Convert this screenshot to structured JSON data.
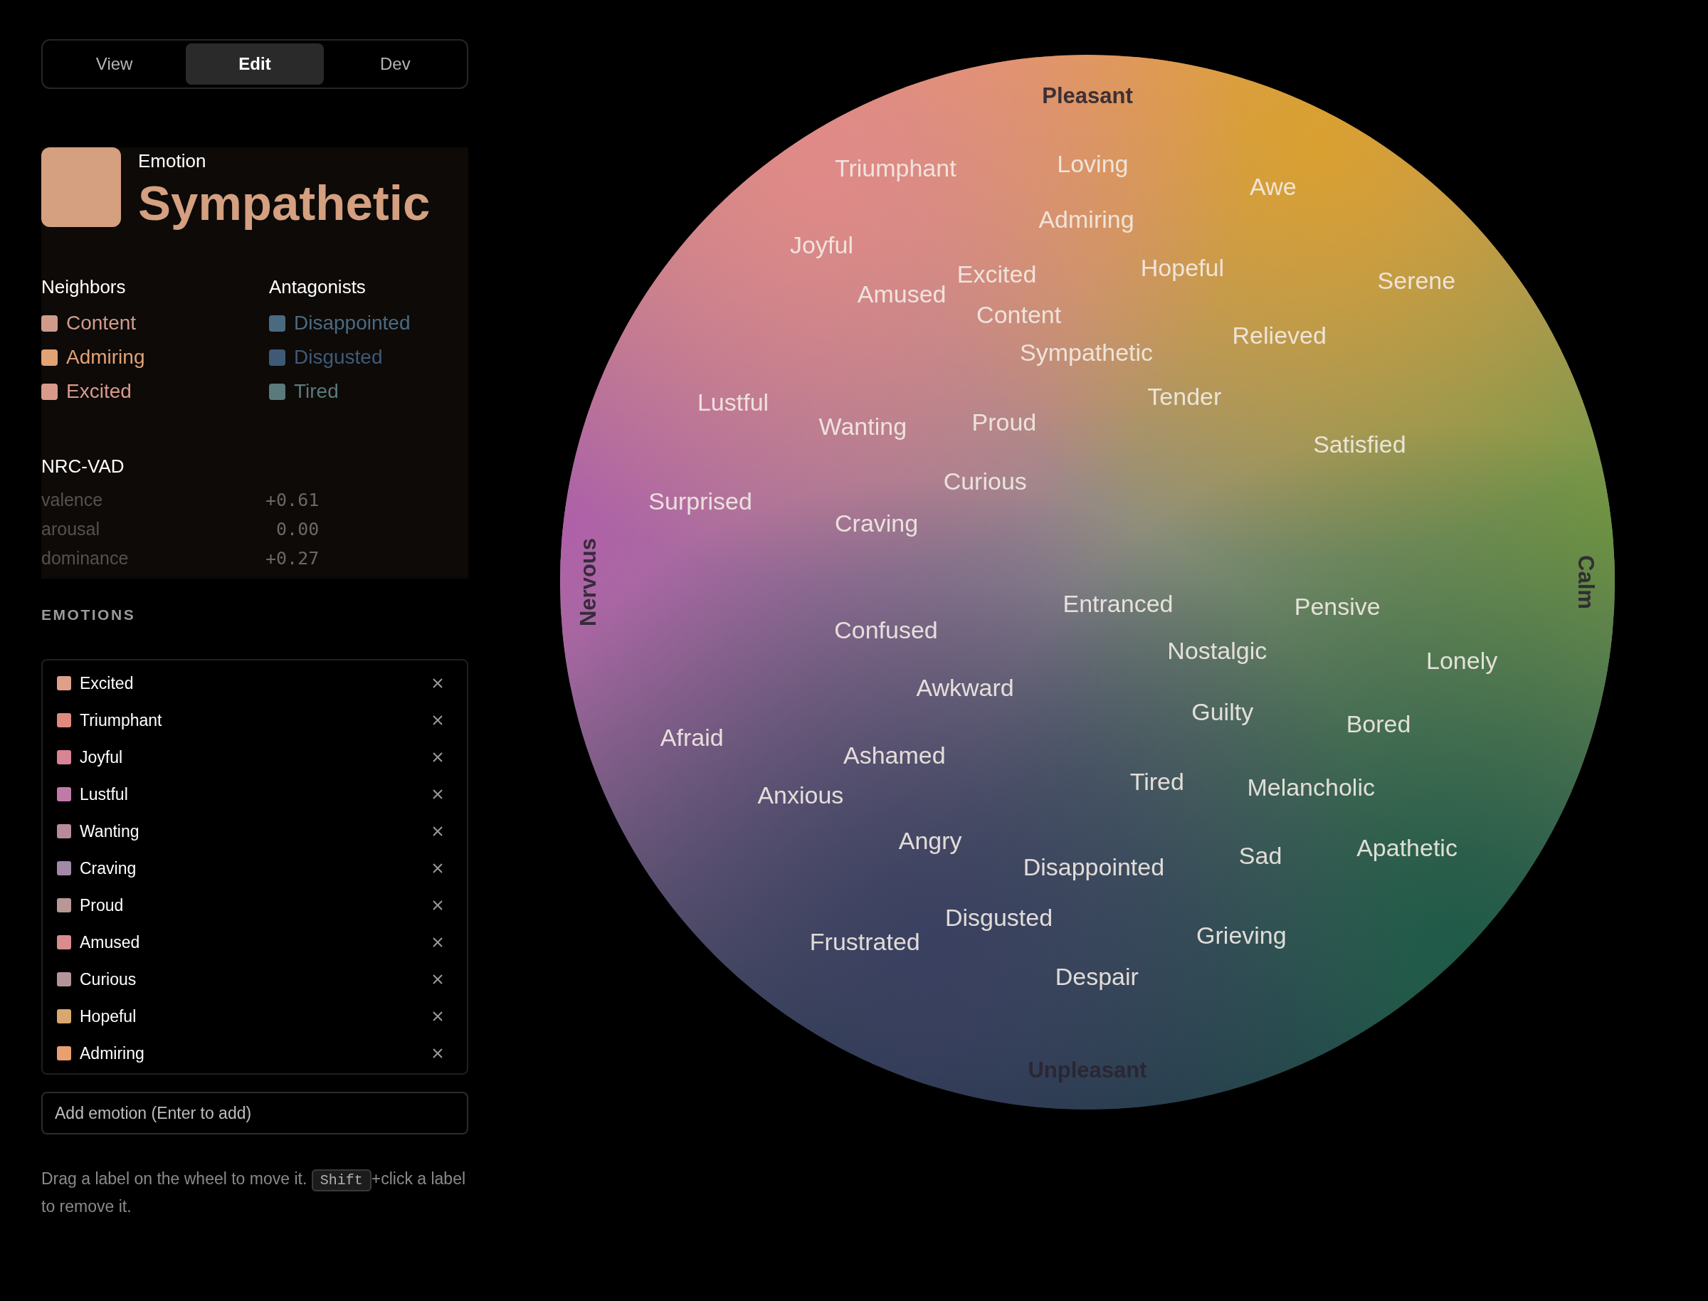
{
  "tabs": [
    {
      "label": "View",
      "selected": false
    },
    {
      "label": "Edit",
      "selected": true
    },
    {
      "label": "Dev",
      "selected": false
    }
  ],
  "emotion": {
    "heading": "Emotion",
    "name": "Sympathetic",
    "color": "#d4a080"
  },
  "neighbors": {
    "title": "Neighbors",
    "items": [
      {
        "label": "Content",
        "color": "#cf9c8c"
      },
      {
        "label": "Admiring",
        "color": "#e2a274"
      },
      {
        "label": "Excited",
        "color": "#d99a8a"
      }
    ]
  },
  "antagonists": {
    "title": "Antagonists",
    "items": [
      {
        "label": "Disappointed",
        "color": "#4a6a80"
      },
      {
        "label": "Disgusted",
        "color": "#3f5a77"
      },
      {
        "label": "Tired",
        "color": "#5a7a7c"
      }
    ]
  },
  "vad": {
    "title": "NRC-VAD",
    "rows": [
      {
        "label": "valence",
        "value": "+0.61"
      },
      {
        "label": "arousal",
        "value": " 0.00"
      },
      {
        "label": "dominance",
        "value": "+0.27"
      }
    ]
  },
  "emotions": {
    "title": "EMOTIONS",
    "items": [
      {
        "label": "Excited",
        "color": "#dfa08a"
      },
      {
        "label": "Triumphant",
        "color": "#e08a7c"
      },
      {
        "label": "Joyful",
        "color": "#d88494"
      },
      {
        "label": "Lustful",
        "color": "#c07aa8"
      },
      {
        "label": "Wanting",
        "color": "#b88a9c"
      },
      {
        "label": "Craving",
        "color": "#a08aa8"
      },
      {
        "label": "Proud",
        "color": "#b89894"
      },
      {
        "label": "Amused",
        "color": "#d88c90"
      },
      {
        "label": "Curious",
        "color": "#b49498"
      },
      {
        "label": "Hopeful",
        "color": "#d8a870"
      },
      {
        "label": "Admiring",
        "color": "#e8a070"
      }
    ]
  },
  "add_field": {
    "placeholder": "Add emotion (Enter to add)"
  },
  "hint": {
    "before": "Drag a label on the wheel to move it.",
    "key": "Shift",
    "after": "+click a label to remove it."
  },
  "wheel": {
    "axes": {
      "top": "Pleasant",
      "bottom": "Unpleasant",
      "left": "Nervous",
      "right": "Calm"
    },
    "labels": [
      "Triumphant",
      "Loving",
      "Awe",
      "Admiring",
      "Joyful",
      "Excited",
      "Hopeful",
      "Serene",
      "Amused",
      "Content",
      "Relieved",
      "Sympathetic",
      "Lustful",
      "Tender",
      "Wanting",
      "Proud",
      "Satisfied",
      "Curious",
      "Surprised",
      "Craving",
      "Entranced",
      "Pensive",
      "Confused",
      "Nostalgic",
      "Lonely",
      "Awkward",
      "Guilty",
      "Bored",
      "Afraid",
      "Ashamed",
      "Tired",
      "Melancholic",
      "Anxious",
      "Angry",
      "Sad",
      "Apathetic",
      "Disappointed",
      "Disgusted",
      "Grieving",
      "Frustrated",
      "Despair"
    ]
  }
}
